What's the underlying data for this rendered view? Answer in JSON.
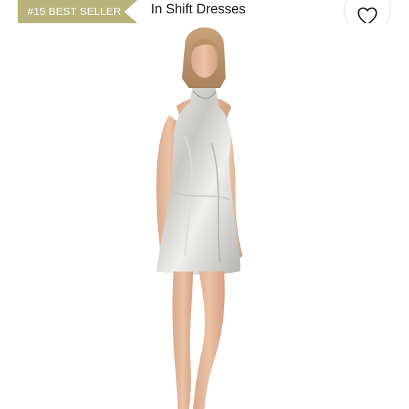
{
  "badge": {
    "label": "#15 BEST SELLER"
  },
  "category": {
    "label": "In Shift Dresses"
  },
  "favorite": {
    "icon": "heart-outline-icon"
  },
  "product": {
    "image_alt": "silver halter mini dress on model"
  },
  "colors": {
    "badge_bg": "#b9b27a",
    "badge_text": "#ffffff",
    "text": "#1a1a1a"
  }
}
